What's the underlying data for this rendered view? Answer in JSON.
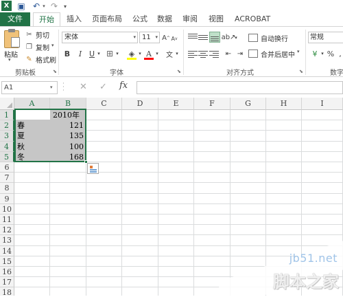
{
  "quick_access": {
    "app_icon": "X",
    "save_glyph": "▣",
    "undo_glyph": "↶",
    "redo_glyph": "↷",
    "dropdown_glyph": "▾"
  },
  "ribbon_tabs": {
    "file": "文件",
    "home": "开始",
    "insert": "插入",
    "layout": "页面布局",
    "formula": "公式",
    "data": "数据",
    "review": "审阅",
    "view": "视图",
    "acrobat": "ACROBAT"
  },
  "clipboard": {
    "paste_label": "粘贴",
    "cut_label": "剪切",
    "copy_label": "复制",
    "format_painter_label": "格式刷",
    "group_label": "剪贴板"
  },
  "font": {
    "name": "宋体",
    "size": "11",
    "grow_label": "A",
    "shrink_label": "A",
    "bold_label": "B",
    "italic_label": "I",
    "underline_label": "U",
    "font_color_label": "A",
    "phonetic_label": "文",
    "group_label": "字体",
    "fill_color": "#ffff00",
    "font_color": "#ff0000"
  },
  "alignment": {
    "wrap_label": "自动换行",
    "merge_label": "合并后居中",
    "group_label": "对齐方式",
    "active": "bottom-align"
  },
  "number": {
    "format": "常规",
    "currency_label": "¥",
    "percent_label": "%",
    "comma_label": ",",
    "group_label": "数字"
  },
  "formula_bar": {
    "name_box": "A1",
    "cancel_glyph": "✕",
    "enter_glyph": "✓",
    "fx_label": "fx",
    "content": ""
  },
  "sheet": {
    "columns": [
      "A",
      "B",
      "C",
      "D",
      "E",
      "F",
      "G",
      "H",
      "I"
    ],
    "rows": [
      "1",
      "2",
      "3",
      "4",
      "5",
      "6",
      "7",
      "8",
      "9",
      "10",
      "11",
      "12",
      "13",
      "14",
      "15",
      "16",
      "17",
      "18"
    ],
    "selected_columns": [
      "A",
      "B"
    ],
    "selected_rows": [
      "1",
      "2",
      "3",
      "4",
      "5"
    ],
    "selection_range": "A1:B5",
    "accent_color": "#217346",
    "cells": {
      "B1": "2010年",
      "A2": "春",
      "B2": "121",
      "A3": "夏",
      "B3": "135",
      "A4": "秋",
      "B4": "100",
      "A5": "冬",
      "B5": "168"
    }
  },
  "watermark": {
    "url": "jb51.net",
    "brand": "脚本之家"
  }
}
